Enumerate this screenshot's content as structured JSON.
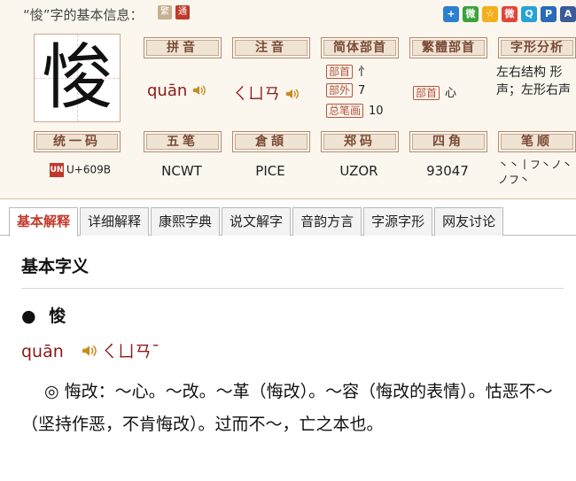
{
  "header": {
    "title": "“悛”字的基本信息：",
    "mode_traditional": "繁",
    "mode_simplified": "通"
  },
  "share": [
    {
      "name": "plus",
      "glyph": "+",
      "color": "#2f7fd1"
    },
    {
      "name": "wechat",
      "glyph": "微",
      "color": "#3aa33a"
    },
    {
      "name": "qzone",
      "glyph": "☆",
      "color": "#f2b01e"
    },
    {
      "name": "weibo",
      "glyph": "微",
      "color": "#e2433b"
    },
    {
      "name": "qq",
      "glyph": "Q",
      "color": "#27a2d8"
    },
    {
      "name": "renren",
      "glyph": "P",
      "color": "#2a6ab8"
    },
    {
      "name": "other",
      "glyph": "A",
      "color": "#3b5b9a"
    }
  ],
  "character": "悛",
  "labels": {
    "pinyin": "拼音",
    "zhuyin": "注音",
    "simp_radical": "简体部首",
    "trad_radical": "繁體部首",
    "structure": "字形分析",
    "unicode": "统一码",
    "wubi": "五笔",
    "cangjie": "倉頡",
    "zhengma": "郑码",
    "sijiao": "四角",
    "strokes": "笔顺"
  },
  "values": {
    "pinyin": "quān",
    "zhuyin": "ㄑㄩㄢ",
    "bushou_label": "部首",
    "bushou": "忄",
    "buwai_label": "部外",
    "buwai": "7",
    "zongbihua_label": "总笔画",
    "zongbihua": "10",
    "trad_bushou_label": "部首",
    "trad_bushou": "心",
    "structure": "左右结构 形声；左形右声",
    "unicode_logo": "UN",
    "unicode": "U+609B",
    "wubi": "NCWT",
    "cangjie": "PICE",
    "zhengma": "UZOR",
    "sijiao": "93047",
    "strokes": "丶丶丨フ丶ノ丶ノフ丶"
  },
  "tabs": [
    {
      "label": "基本解释",
      "active": true
    },
    {
      "label": "详细解释",
      "active": false
    },
    {
      "label": "康熙字典",
      "active": false
    },
    {
      "label": "说文解字",
      "active": false
    },
    {
      "label": "音韵方言",
      "active": false
    },
    {
      "label": "字源字形",
      "active": false
    },
    {
      "label": "网友讨论",
      "active": false
    }
  ],
  "content": {
    "section_title": "基本字义",
    "entry_bullet": "●",
    "entry_char": "悛",
    "entry_pinyin": "quān",
    "entry_zhuyin": "ㄑㄩㄢˉ",
    "definition": "◎ 悔改：～心。～改。～革（悔改）。～容（悔改的表情）。怙恶不～（坚持作恶，不肯悔改）。过而不～，亡之本也。"
  }
}
